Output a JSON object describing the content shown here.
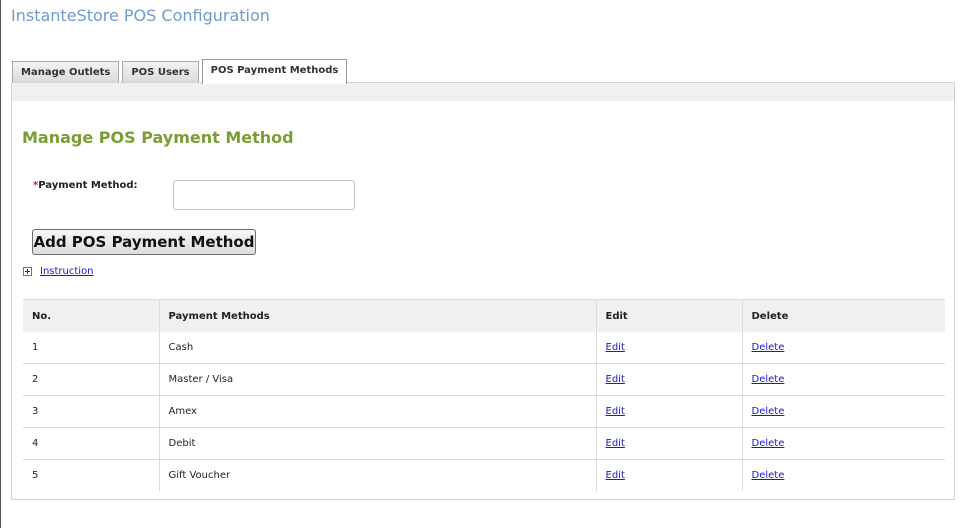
{
  "app": {
    "title": "InstanteStore POS Configuration"
  },
  "tabs": [
    {
      "label": "Manage Outlets",
      "active": false
    },
    {
      "label": "POS Users",
      "active": false
    },
    {
      "label": "POS Payment Methods",
      "active": true
    }
  ],
  "form": {
    "section_title": "Manage POS Payment Method",
    "required_marker": "*",
    "payment_method_label": "Payment Method:",
    "payment_method_value": "",
    "add_button_label": "Add POS Payment Method",
    "instruction_link": "Instruction"
  },
  "table": {
    "headers": [
      "No.",
      "Payment Methods",
      "Edit",
      "Delete"
    ],
    "rows": [
      {
        "no": "1",
        "method": "Cash",
        "edit": "Edit",
        "delete": "Delete"
      },
      {
        "no": "2",
        "method": "Master / Visa",
        "edit": "Edit",
        "delete": "Delete"
      },
      {
        "no": "3",
        "method": "Amex",
        "edit": "Edit",
        "delete": "Delete"
      },
      {
        "no": "4",
        "method": "Debit",
        "edit": "Edit",
        "delete": "Delete"
      },
      {
        "no": "5",
        "method": "Gift Voucher",
        "edit": "Edit",
        "delete": "Delete"
      }
    ]
  },
  "colors": {
    "title": "#6d9ccd",
    "section_title": "#7a9e35",
    "link": "#1a1acc",
    "required": "#cc2222"
  }
}
